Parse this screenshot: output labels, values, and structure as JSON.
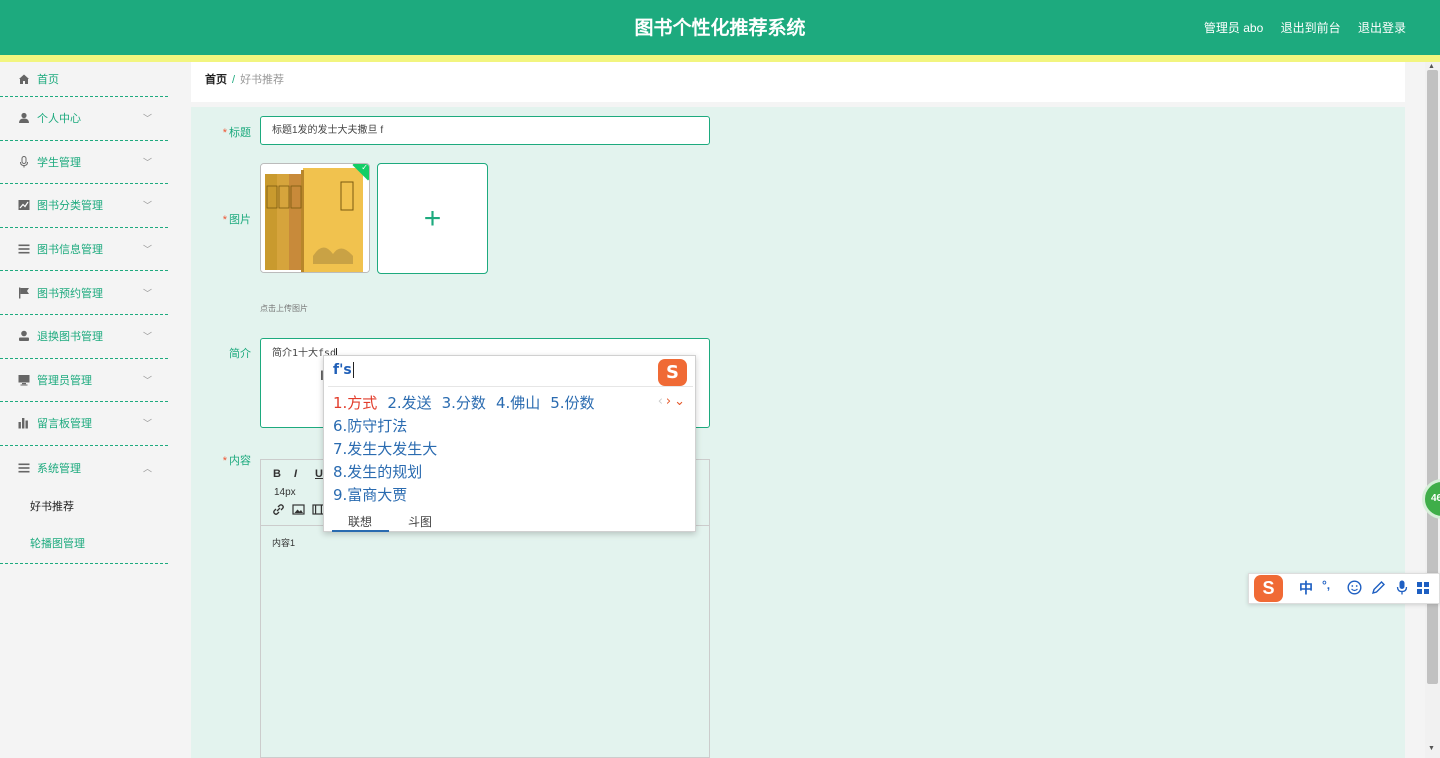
{
  "header": {
    "title": "图书个性化推荐系统",
    "admin": "管理员 abo",
    "front": "退出到前台",
    "logout": "退出登录"
  },
  "sidebar": {
    "home": "首页",
    "items": [
      {
        "label": "个人中心",
        "icon": "person-icon"
      },
      {
        "label": "学生管理",
        "icon": "microphone-icon"
      },
      {
        "label": "图书分类管理",
        "icon": "chart-icon"
      },
      {
        "label": "图书信息管理",
        "icon": "list-icon"
      },
      {
        "label": "图书预约管理",
        "icon": "flag-icon"
      },
      {
        "label": "退换图书管理",
        "icon": "user-icon"
      },
      {
        "label": "管理员管理",
        "icon": "monitor-icon"
      },
      {
        "label": "留言板管理",
        "icon": "bar-chart-icon"
      },
      {
        "label": "系统管理",
        "icon": "menu-icon"
      }
    ],
    "sub": [
      "好书推荐",
      "轮播图管理"
    ]
  },
  "breadcrumb": {
    "home": "首页",
    "sep": "/",
    "current": "好书推荐"
  },
  "form": {
    "title_label": "标题",
    "title_value": "标题1发的发士大夫撒旦 f",
    "image_label": "图片",
    "upload_tip": "点击上传图片",
    "intro_label": "简介",
    "intro_value": "简介1十大fsd",
    "content_label": "内容",
    "font_size": "14px",
    "content_value": "内容1"
  },
  "editor_toolbar": {
    "bold": "B",
    "italic": "I",
    "underline": "U"
  },
  "ime": {
    "composition": "f's",
    "candidates": [
      "1.方式",
      "2.发送",
      "3.分数",
      "4.佛山",
      "5.份数"
    ],
    "more": [
      "6.防守打法",
      "7.发生大发生大",
      "8.发生的规划",
      "9.富商大贾"
    ],
    "tab_assoc": "联想",
    "tab_meme": "斗图",
    "logo": "S"
  },
  "ime_bar": {
    "logo": "S",
    "lang": "中",
    "punct": "°,"
  },
  "badge": "46",
  "colors": {
    "primary": "#1daa7e",
    "stripe": "#f2f57f",
    "form_bg": "#e3f3ee"
  }
}
